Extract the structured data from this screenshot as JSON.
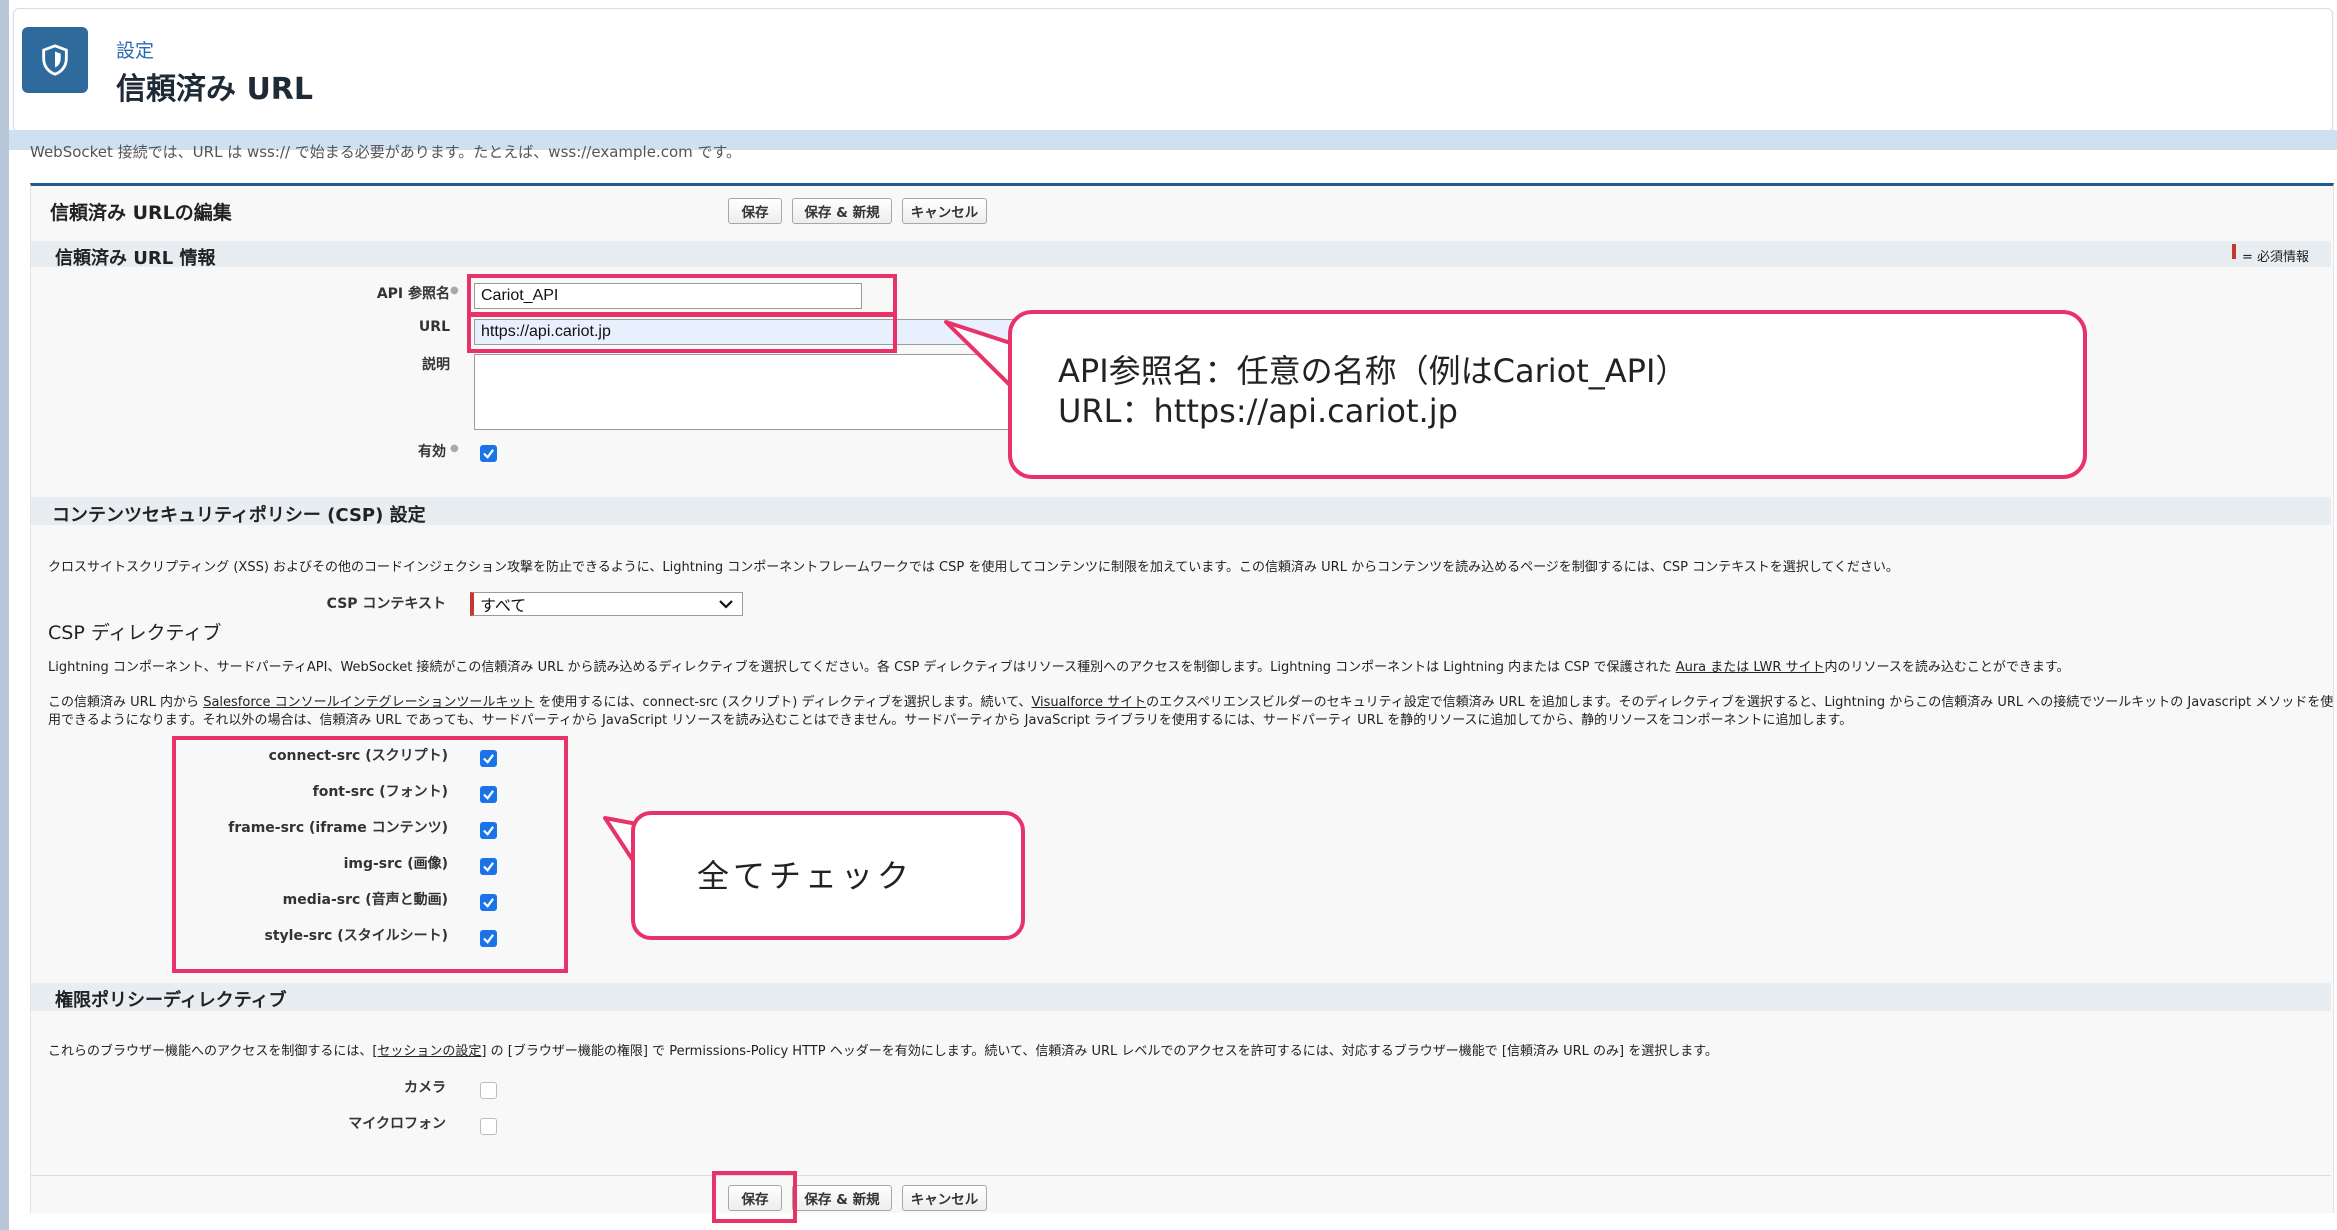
{
  "header": {
    "breadcrumb": "設定",
    "title": "信頼済み URL"
  },
  "intro_text": "WebSocket 接続では、URL は wss:// で始まる必要があります。たとえば、wss://example.com です。",
  "form": {
    "title": "信頼済み URLの編集",
    "buttons": {
      "save": "保存",
      "save_new": "保存 & 新規",
      "cancel": "キャンセル"
    },
    "info_section": {
      "title": "信頼済み URL 情報",
      "required_legend": "= 必須情報",
      "api_name_label": "API 参照名",
      "api_name_value": "Cariot_API",
      "url_label": "URL",
      "url_value": "https://api.cariot.jp",
      "description_label": "説明",
      "description_value": "",
      "active_label": "有効",
      "active_checked": true
    },
    "csp_section": {
      "title": "コンテンツセキュリティポリシー (CSP) 設定",
      "description": "クロスサイトスクリプティング (XSS) およびその他のコードインジェクション攻撃を防止できるように、Lightning コンポーネントフレームワークでは CSP を使用してコンテンツに制限を加えています。この信頼済み URL からコンテンツを読み込めるページを制御するには、CSP コンテキストを選択してください。",
      "context_label": "CSP コンテキスト",
      "context_value": "すべて",
      "directives_title": "CSP ディレクティブ",
      "directives_desc_pre": "Lightning コンポーネント、サードパーティAPI、WebSocket 接続がこの信頼済み URL から読み込めるディレクティブを選択してください。各 CSP ディレクティブはリソース種別へのアクセスを制御します。Lightning コンポーネントは Lightning 内または CSP で保護された ",
      "directives_desc_link": "Aura または LWR サイト",
      "directives_desc_post": "内のリソースを読み込むことができます。",
      "toolkit_pre": "この信頼済み URL 内から ",
      "toolkit_link1": "Salesforce コンソールインテグレーションツールキット",
      "toolkit_mid": " を使用するには、connect-src (スクリプト) ディレクティブを選択します。続いて、",
      "toolkit_link2": "Visualforce サイト",
      "toolkit_post": "のエクスペリエンスビルダーのセキュリティ設定で信頼済み URL を追加します。そのディレクティブを選択すると、Lightning からこの信頼済み URL への接続でツールキットの Javascript メソッドを使",
      "toolkit_line2": "用できるようになります。それ以外の場合は、信頼済み URL であっても、サードパーティから JavaScript リソースを読み込むことはできません。サードパーティから JavaScript ライブラリを使用するには、サードパーティ URL を静的リソースに追加してから、静的リソースをコンポーネントに追加します。",
      "directives": [
        {
          "label": "connect-src (スクリプト)",
          "checked": true
        },
        {
          "label": "font-src (フォント)",
          "checked": true
        },
        {
          "label": "frame-src (iframe コンテンツ)",
          "checked": true
        },
        {
          "label": "img-src (画像)",
          "checked": true
        },
        {
          "label": "media-src (音声と動画)",
          "checked": true
        },
        {
          "label": "style-src (スタイルシート)",
          "checked": true
        }
      ]
    },
    "permissions_section": {
      "title": "権限ポリシーディレクティブ",
      "desc_pre": "これらのブラウザー機能へのアクセスを制御するには、",
      "desc_link": "[セッションの設定]",
      "desc_post": " の [ブラウザー機能の権限] で Permissions-Policy HTTP ヘッダーを有効にします。続いて、信頼済み URL レベルでのアクセスを許可するには、対応するブラウザー機能で [信頼済み URL のみ] を選択します。",
      "camera_label": "カメラ",
      "camera_checked": false,
      "microphone_label": "マイクロフォン",
      "microphone_checked": false
    }
  },
  "annotations": {
    "callout1_line1": "API参照名：任意の名称（例はCariot_API）",
    "callout1_line2": "URL：https://api.cariot.jp",
    "callout2": "全てチェック"
  },
  "colors": {
    "highlight": "#e8336a",
    "checkbox": "#1a73e8",
    "header_icon": "#2e6a9b"
  }
}
